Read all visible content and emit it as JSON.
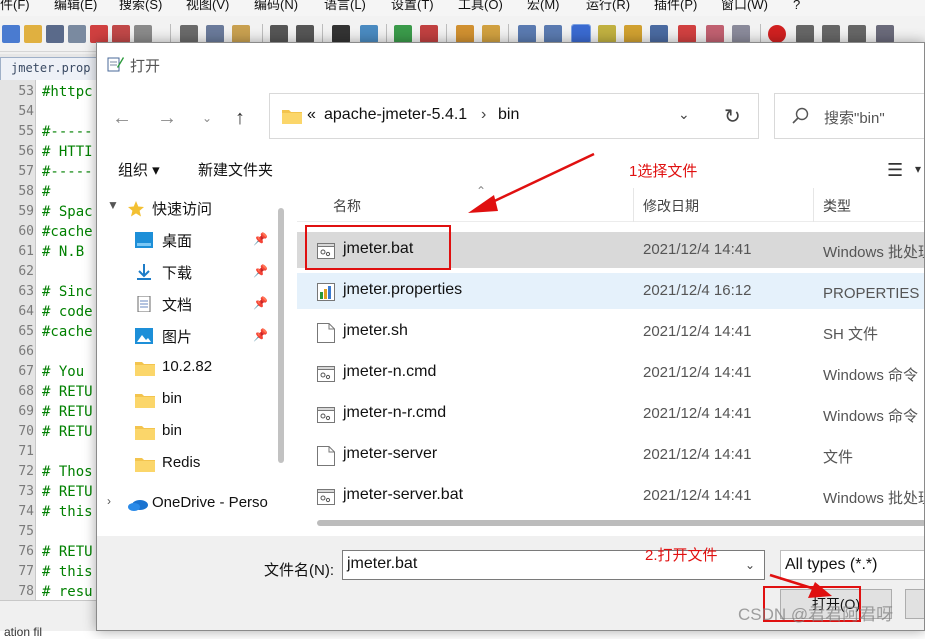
{
  "editor": {
    "menu": [
      "件(F)",
      "编辑(E)",
      "搜索(S)",
      "视图(V)",
      "编码(N)",
      "语言(L)",
      "设置(T)",
      "工具(O)",
      "宏(M)",
      "运行(R)",
      "插件(P)",
      "窗口(W)",
      "?"
    ],
    "tab_label": "jmeter.prop",
    "lines": [
      {
        "n": "53",
        "t": "#httpc"
      },
      {
        "n": "54",
        "t": ""
      },
      {
        "n": "55",
        "t": "#-----"
      },
      {
        "n": "56",
        "t": "# HTTI"
      },
      {
        "n": "57",
        "t": "#-----"
      },
      {
        "n": "58",
        "t": "#"
      },
      {
        "n": "59",
        "t": "# Spac"
      },
      {
        "n": "60",
        "t": "#cache"
      },
      {
        "n": "61",
        "t": "# N.B"
      },
      {
        "n": "62",
        "t": ""
      },
      {
        "n": "63",
        "t": "# Sinc"
      },
      {
        "n": "64",
        "t": "# code"
      },
      {
        "n": "65",
        "t": "#cache"
      },
      {
        "n": "66",
        "t": ""
      },
      {
        "n": "67",
        "t": "# You"
      },
      {
        "n": "68",
        "t": "# RETU"
      },
      {
        "n": "69",
        "t": "# RETU"
      },
      {
        "n": "70",
        "t": "# RETU"
      },
      {
        "n": "71",
        "t": ""
      },
      {
        "n": "72",
        "t": "# Thos"
      },
      {
        "n": "73",
        "t": "# RETU"
      },
      {
        "n": "74",
        "t": "# this"
      },
      {
        "n": "75",
        "t": ""
      },
      {
        "n": "76",
        "t": "# RETU"
      },
      {
        "n": "77",
        "t": "# this"
      },
      {
        "n": "78",
        "t": "# resu"
      }
    ],
    "status_text": "ation fil"
  },
  "dialog": {
    "title": "打开",
    "address": {
      "prefix": "«",
      "segments": [
        "apache-jmeter-5.4.1",
        "bin"
      ],
      "separator": "›"
    },
    "search_placeholder": "搜索\"bin\"",
    "organize_label": "组织 ▾",
    "newfolder_label": "新建文件夹",
    "nav_items": [
      {
        "label": "快速访问",
        "icon": "star-icon",
        "kind": "header",
        "pinned": false
      },
      {
        "label": "桌面",
        "icon": "desktop-icon",
        "kind": "item",
        "pinned": true
      },
      {
        "label": "下载",
        "icon": "download-icon",
        "kind": "item",
        "pinned": true
      },
      {
        "label": "文档",
        "icon": "document-icon",
        "kind": "item",
        "pinned": true
      },
      {
        "label": "图片",
        "icon": "pictures-icon",
        "kind": "item",
        "pinned": true
      },
      {
        "label": "10.2.82",
        "icon": "folder-icon",
        "kind": "item",
        "pinned": false
      },
      {
        "label": "bin",
        "icon": "folder-icon",
        "kind": "item",
        "pinned": false
      },
      {
        "label": "bin",
        "icon": "folder-icon",
        "kind": "item",
        "pinned": false
      },
      {
        "label": "Redis",
        "icon": "folder-icon",
        "kind": "item",
        "pinned": false
      },
      {
        "label": "OneDrive - Perso",
        "icon": "onedrive-icon",
        "kind": "header",
        "pinned": false
      }
    ],
    "columns": {
      "name": "名称",
      "date": "修改日期",
      "type": "类型"
    },
    "files": [
      {
        "name": "jmeter.bat",
        "date": "2021/12/4 14:41",
        "type": "Windows 批处理",
        "icon": "batch-file-icon",
        "state": "selected"
      },
      {
        "name": "jmeter.properties",
        "date": "2021/12/4 16:12",
        "type": "PROPERTIES 文",
        "icon": "properties-file-icon",
        "state": "hover"
      },
      {
        "name": "jmeter.sh",
        "date": "2021/12/4 14:41",
        "type": "SH 文件",
        "icon": "file-icon",
        "state": ""
      },
      {
        "name": "jmeter-n.cmd",
        "date": "2021/12/4 14:41",
        "type": "Windows 命令",
        "icon": "batch-file-icon",
        "state": ""
      },
      {
        "name": "jmeter-n-r.cmd",
        "date": "2021/12/4 14:41",
        "type": "Windows 命令",
        "icon": "batch-file-icon",
        "state": ""
      },
      {
        "name": "jmeter-server",
        "date": "2021/12/4 14:41",
        "type": "文件",
        "icon": "file-icon",
        "state": ""
      },
      {
        "name": "jmeter-server.bat",
        "date": "2021/12/4 14:41",
        "type": "Windows 批处理",
        "icon": "batch-file-icon",
        "state": ""
      }
    ],
    "filename_label": "文件名(N):",
    "filename_value": "jmeter.bat",
    "filetype_value": "All types (*.*)",
    "open_label": "打开(O)"
  },
  "annotations": {
    "step1": "1选择文件",
    "step2": "2.打开文件",
    "color": "#e01010"
  },
  "watermark": "CSDN @君君阿君呀"
}
